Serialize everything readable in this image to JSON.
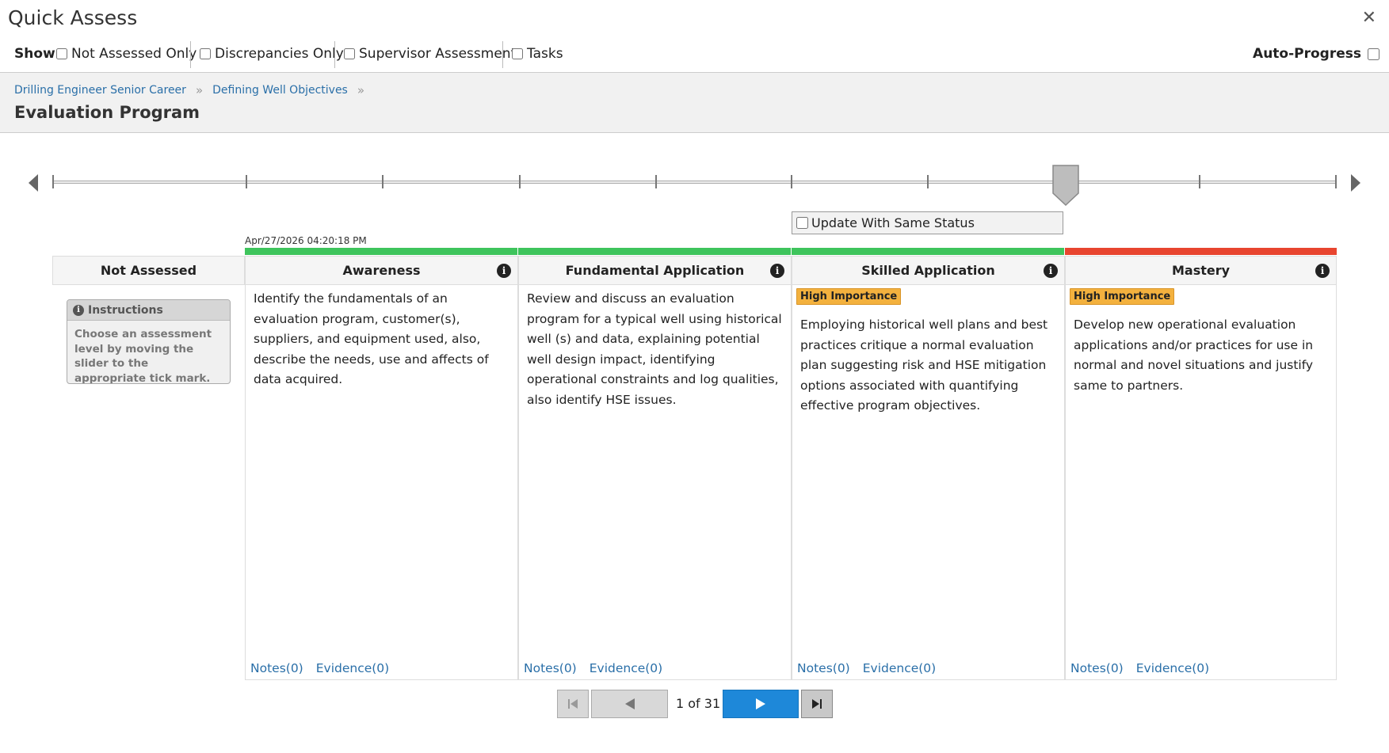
{
  "window": {
    "title": "Quick Assess",
    "close_glyph": "✕"
  },
  "filters": {
    "show_label": "Show",
    "items": [
      {
        "label": "Not Assessed Only",
        "checked": false
      },
      {
        "label": "Discrepancies Only",
        "checked": false
      },
      {
        "label": "Supervisor Assessment",
        "checked": false
      },
      {
        "label": "Tasks",
        "checked": false
      }
    ],
    "auto_progress_label": "Auto-Progress"
  },
  "breadcrumb": {
    "items": [
      "Drilling Engineer Senior Career",
      "Defining Well Objectives"
    ],
    "separator": "»"
  },
  "page_title": "Evaluation Program",
  "slider": {
    "tick_count": 10,
    "selected_tick": 7
  },
  "update_same_status_label": "Update With Same Status",
  "timestamp": "Apr/27/2026 04:20:18 PM",
  "colors": {
    "status_green": "#3ec45c",
    "status_red": "#e8452f",
    "badge": "#f3b13e",
    "primary": "#1e88d9",
    "link": "#2a6fa8"
  },
  "not_assessed": {
    "label": "Not Assessed",
    "instructions_title": "Instructions",
    "instructions_text": "Choose an assessment level by moving the slider to the appropriate tick mark."
  },
  "levels": [
    {
      "name": "Awareness",
      "status": "green",
      "badge": "",
      "description": "Identify the fundamentals of an evaluation program, customer(s), suppliers, and equipment used, also, describe the needs, use and affects of data acquired.",
      "notes": "Notes(0)",
      "evidence": "Evidence(0)"
    },
    {
      "name": "Fundamental Application",
      "status": "green",
      "badge": "",
      "description": "Review and discuss an evaluation program for a typical well using historical well (s) and data, explaining potential well design impact, identifying operational constraints and log qualities, also identify HSE issues.",
      "notes": "Notes(0)",
      "evidence": "Evidence(0)"
    },
    {
      "name": "Skilled Application",
      "status": "green",
      "badge": "High Importance",
      "description": "Employing historical well plans and best practices critique a normal evaluation plan suggesting risk and HSE mitigation options associated with quantifying effective program objectives.",
      "notes": "Notes(0)",
      "evidence": "Evidence(0)"
    },
    {
      "name": "Mastery",
      "status": "red",
      "badge": "High Importance",
      "description": "Develop new operational evaluation applications and/or practices for use in normal and novel situations and justify same to partners.",
      "notes": "Notes(0)",
      "evidence": "Evidence(0)"
    }
  ],
  "pager": {
    "text": "1 of 31"
  }
}
